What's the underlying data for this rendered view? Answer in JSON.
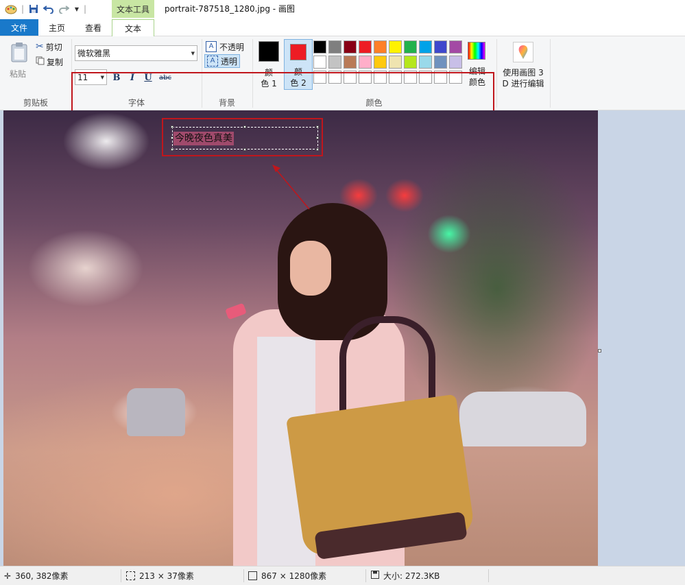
{
  "title_bar": {
    "context_tab_group": "文本工具",
    "window_title": "portrait-787518_1280.jpg - 画图"
  },
  "tabs": {
    "file": "文件",
    "home": "主页",
    "view": "查看",
    "text": "文本"
  },
  "clipboard": {
    "paste": "粘贴",
    "cut": "剪切",
    "copy": "复制",
    "group_label": "剪贴板"
  },
  "font": {
    "family": "微软雅黑",
    "size": "11",
    "bold": "B",
    "italic": "I",
    "underline": "U",
    "strikethrough": "abc",
    "group_label": "字体"
  },
  "background": {
    "opaque": "不透明",
    "transparent": "透明",
    "group_label": "背景"
  },
  "colors": {
    "color1_label_line1": "颜",
    "color1_label_line2": "色 1",
    "color2_label_line1": "颜",
    "color2_label_line2": "色 2",
    "color1_value": "#000000",
    "color2_value": "#ed1c24",
    "palette_row1": [
      "#000000",
      "#7f7f7f",
      "#880015",
      "#ed1c24",
      "#ff7f27",
      "#fff200",
      "#22b14c",
      "#00a2e8",
      "#3f48cc",
      "#a349a4"
    ],
    "palette_row2": [
      "#ffffff",
      "#c3c3c3",
      "#b97a57",
      "#ffaec9",
      "#ffc90e",
      "#efe4b0",
      "#b5e61d",
      "#99d9ea",
      "#7092be",
      "#c8bfe7"
    ],
    "edit_line1": "编辑",
    "edit_line2": "颜色",
    "group_label": "颜色"
  },
  "paint3d": {
    "line1": "使用画图 3",
    "line2": "D 进行编辑"
  },
  "canvas": {
    "text_content": "今晚夜色真美"
  },
  "status_bar": {
    "cursor_position": "360, 382像素",
    "selection_size": "213 × 37像素",
    "image_size": "867 × 1280像素",
    "file_size": "大小: 272.3KB"
  }
}
